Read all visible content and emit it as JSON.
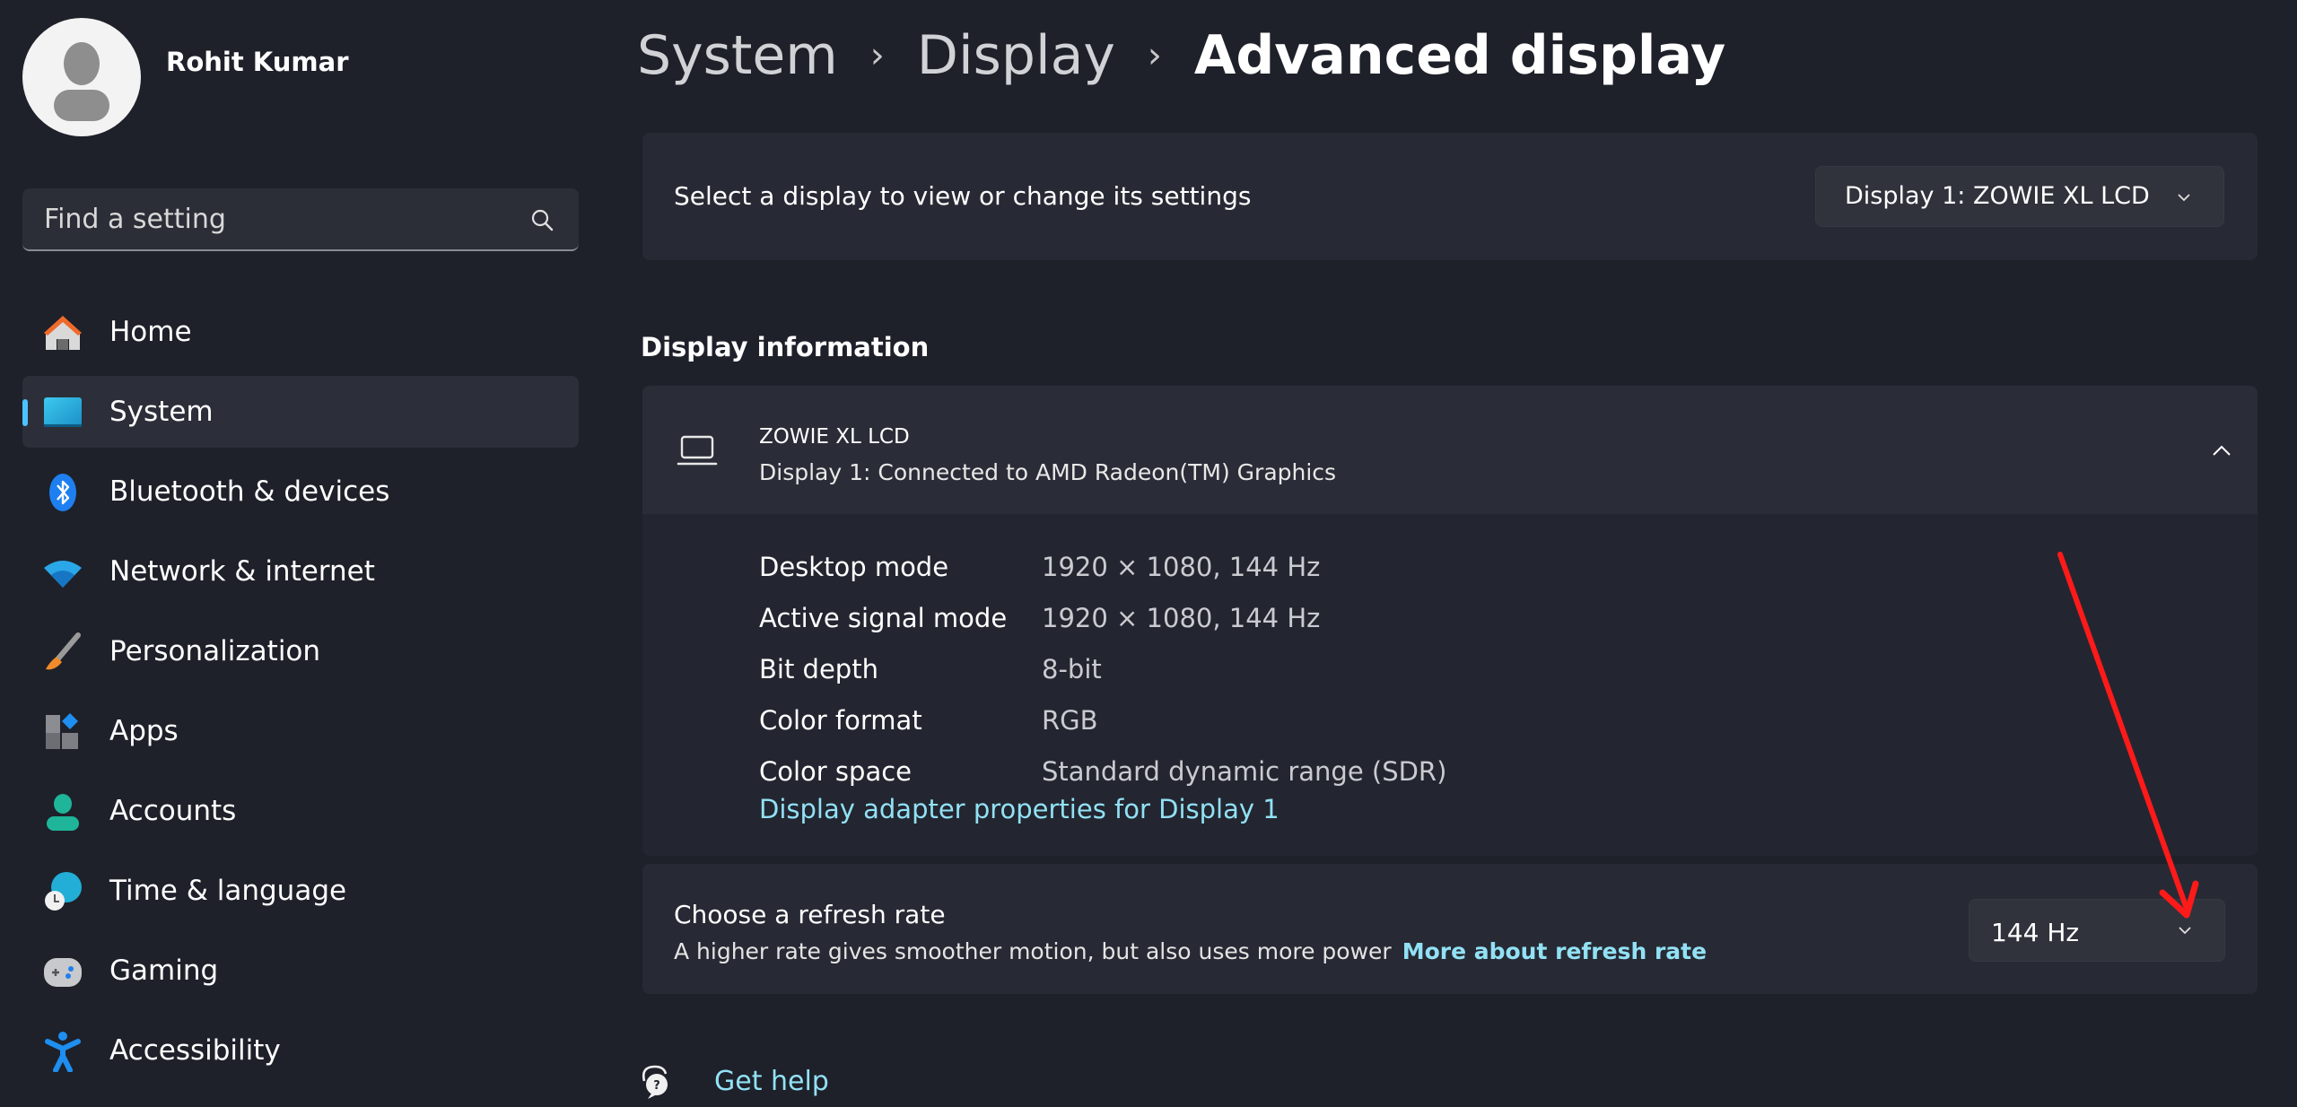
{
  "user": {
    "name": "Rohit Kumar"
  },
  "search": {
    "placeholder": "Find a setting",
    "value": ""
  },
  "sidebar": {
    "items": [
      {
        "label": "Home",
        "icon": "home-icon",
        "selected": false
      },
      {
        "label": "System",
        "icon": "system-icon",
        "selected": true
      },
      {
        "label": "Bluetooth & devices",
        "icon": "bluetooth-icon",
        "selected": false
      },
      {
        "label": "Network & internet",
        "icon": "wifi-icon",
        "selected": false
      },
      {
        "label": "Personalization",
        "icon": "paintbrush-icon",
        "selected": false
      },
      {
        "label": "Apps",
        "icon": "apps-icon",
        "selected": false
      },
      {
        "label": "Accounts",
        "icon": "accounts-icon",
        "selected": false
      },
      {
        "label": "Time & language",
        "icon": "time-language-icon",
        "selected": false
      },
      {
        "label": "Gaming",
        "icon": "gamepad-icon",
        "selected": false
      },
      {
        "label": "Accessibility",
        "icon": "accessibility-icon",
        "selected": false
      }
    ]
  },
  "breadcrumb": {
    "items": [
      "System",
      "Display",
      "Advanced display"
    ],
    "separator": "›"
  },
  "display_select": {
    "label": "Select a display to view or change its settings",
    "selected": "Display 1: ZOWIE XL LCD"
  },
  "display_info": {
    "section_title": "Display information",
    "monitor_name": "ZOWIE XL LCD",
    "connection": "Display 1: Connected to AMD Radeon(TM) Graphics",
    "expanded": true,
    "rows": [
      {
        "key": "Desktop mode",
        "value": "1920 × 1080, 144 Hz"
      },
      {
        "key": "Active signal mode",
        "value": "1920 × 1080, 144 Hz"
      },
      {
        "key": "Bit depth",
        "value": "8-bit"
      },
      {
        "key": "Color format",
        "value": "RGB"
      },
      {
        "key": "Color space",
        "value": "Standard dynamic range (SDR)"
      }
    ],
    "adapter_link": "Display adapter properties for Display 1"
  },
  "refresh_rate": {
    "title": "Choose a refresh rate",
    "description": "A higher rate gives smoother motion, but also uses more power",
    "more_link": "More about refresh rate",
    "selected": "144 Hz"
  },
  "help": {
    "label": "Get help"
  },
  "colors": {
    "accent": "#4cc2ff",
    "link": "#92e1f5",
    "annotation_arrow": "#ff1a1a"
  }
}
